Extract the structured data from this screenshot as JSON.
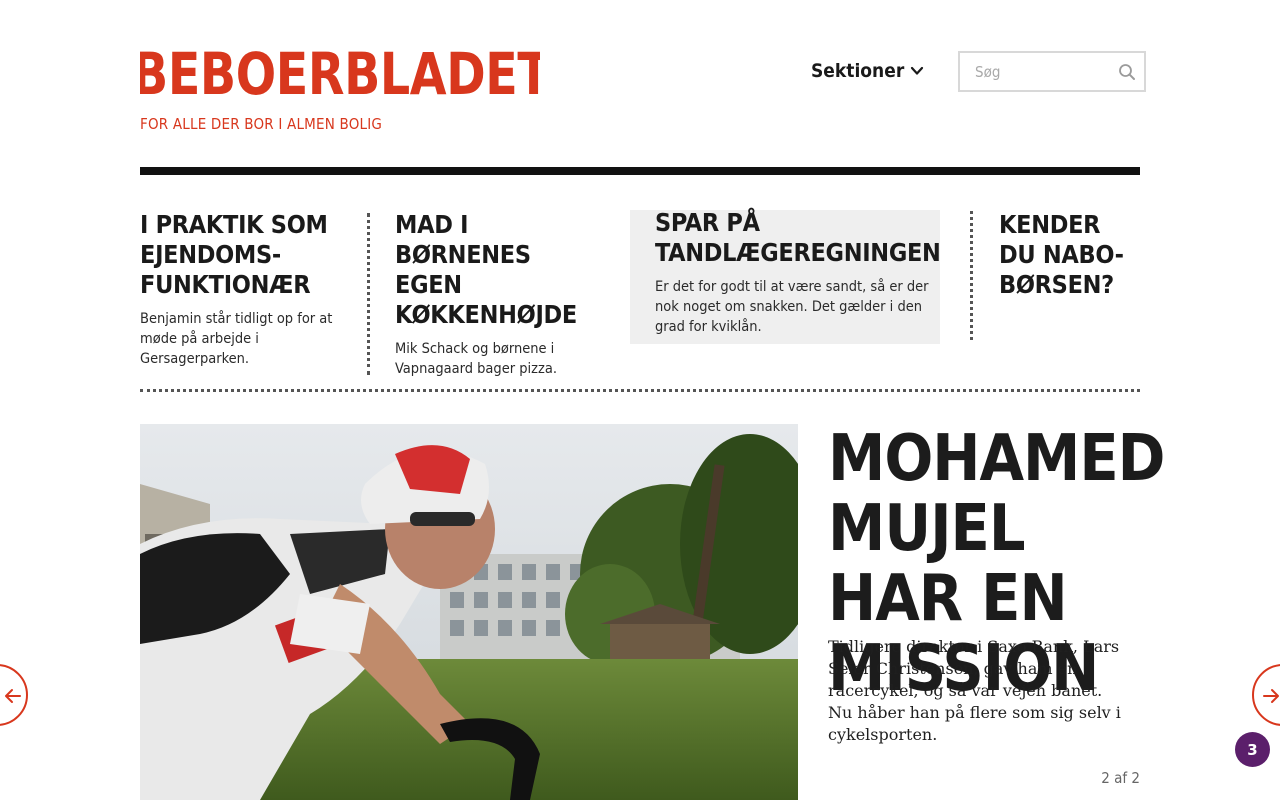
{
  "header": {
    "logo_text": "BEBOERBLADET",
    "tagline": "FOR ALLE DER BOR I ALMEN BOLIG",
    "sections_label": "Sektioner",
    "search_placeholder": "Søg"
  },
  "teasers": [
    {
      "title": "I PRAKTIK SOM EJENDOMS-FUNKTIONÆR",
      "summary": "Benjamin står tidligt op for at møde på arbejde i Gersagerparken."
    },
    {
      "title": "MAD I BØRNENES EGEN KØKKENHØJDE",
      "summary": "Mik Schack og børnene i Vapnagaard bager pizza."
    },
    {
      "title": "SPAR PÅ TANDLÆGEREGNINGEN",
      "summary": "Er det for godt til at være sandt, så er der nok noget om snakken. Det gælder i den grad for kviklån."
    },
    {
      "title": "KENDER DU NABO-BØRSEN?",
      "summary": ""
    }
  ],
  "feature": {
    "headline": "MOHAMED MUJEL HAR EN MISSION",
    "lede": "Tidligere direktør i Saxo Bank, Lars Seier Christensen, gav ham en racercykel, og så var vejen banet. Nu håber han på flere som sig selv i cykelsporten.",
    "pager": "2 af 2"
  },
  "notification_count": "3",
  "colors": {
    "brand": "#d8371d",
    "badge": "#5b1f6b",
    "teaser_highlight": "#efefef"
  },
  "icons": {
    "sections": "chevron-down-icon",
    "search": "search-icon",
    "prev": "arrow-left-icon",
    "next": "arrow-right-icon"
  }
}
